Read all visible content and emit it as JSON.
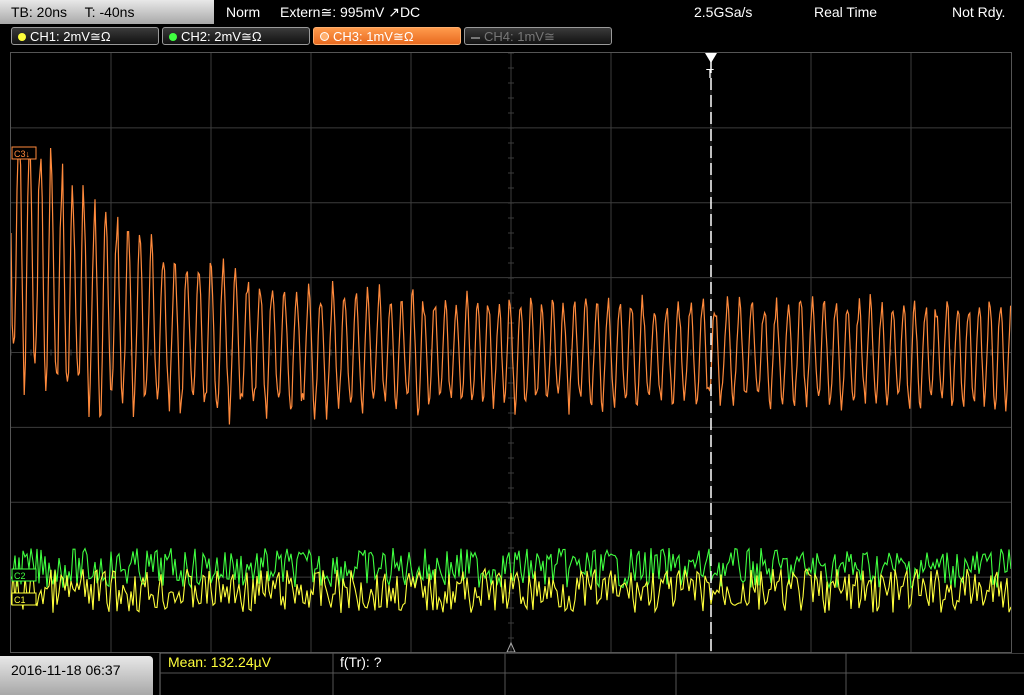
{
  "status": {
    "timebase": "TB: 20ns",
    "trigger_time": "T: -40ns",
    "trigger_mode": "Norm",
    "trigger_source": "Extern≅: 995mV ↗DC",
    "sample_rate": "2.5GSa/s",
    "acq_mode": "Real Time",
    "state": "Not Rdy."
  },
  "channels": [
    {
      "label": "CH1: 2mV≅Ω",
      "color": "#ffff3c",
      "active": true
    },
    {
      "label": "CH2: 2mV≅Ω",
      "color": "#40ff40",
      "active": true
    },
    {
      "label": "CH3: 1mV≅Ω",
      "color": "#ff8a3c",
      "active": true,
      "selected": true
    },
    {
      "label": "CH4: 1mV≅",
      "color": "#888888",
      "active": false
    }
  ],
  "markers": {
    "ch3": "C3↓",
    "ch2": "C2",
    "ch1": "C1",
    "trigger": "T"
  },
  "footer": {
    "datetime": "2016-11-18 06:37",
    "measurement": "Mean: 132.24µV",
    "frequency": "f(Tr): ?"
  },
  "colors": {
    "ch1": "#ffff3c",
    "ch2": "#40ff40",
    "ch3": "#ff8a3c",
    "grid": "#3c3c3c",
    "trigger_line": "#ffffff"
  }
}
